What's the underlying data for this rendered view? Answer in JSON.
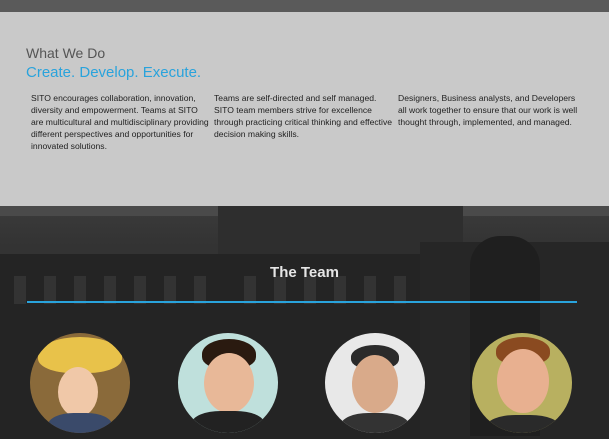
{
  "what_we_do": {
    "heading": "What We Do",
    "tagline": "Create. Develop. Execute.",
    "columns": [
      "SITO encourages collaboration, innovation, diversity and empowerment. Teams at SITO are multicultural and multidisciplinary providing different perspectives and opportunities for innovated solutions.",
      "Teams are self-directed and self managed. SITO team members strive for excellence through practicing critical thinking and effective decision making skills.",
      "Designers, Business analysts, and Developers all work together to ensure that our work is well thought through, implemented, and managed."
    ]
  },
  "team": {
    "heading": "The Team"
  },
  "colors": {
    "accent": "#29a3dc",
    "panel": "#c9c9c9",
    "dark_band": "#2d2d2d"
  }
}
